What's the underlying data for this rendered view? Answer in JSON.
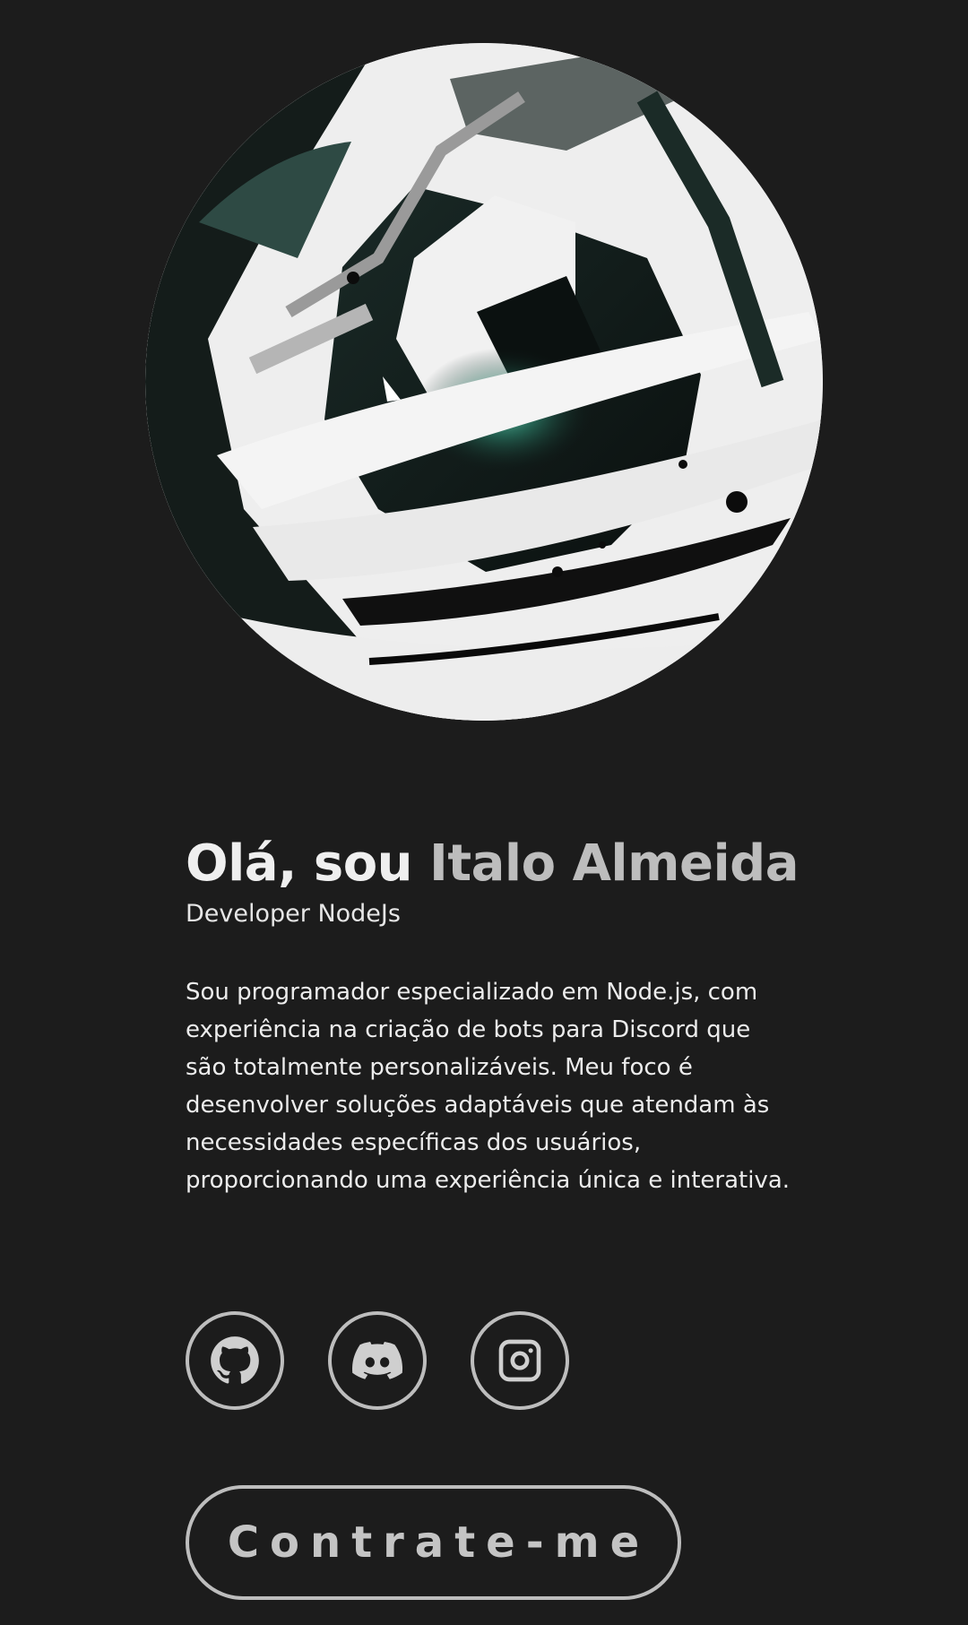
{
  "profile": {
    "avatar_alt": "abstract ink hooded figure avatar",
    "greeting_prefix": "Olá, sou ",
    "name": "Italo Almeida",
    "role": "Developer NodeJs",
    "bio": "Sou programador especializado em Node.js, com experiência na criação de bots para Discord que são totalmente personalizáveis. Meu foco é desenvolver soluções adaptáveis que atendam às necessidades específicas dos usuários, proporcionando uma experiência única e interativa."
  },
  "socials": [
    {
      "name": "GitHub",
      "icon": "github-icon"
    },
    {
      "name": "Discord",
      "icon": "discord-icon"
    },
    {
      "name": "Instagram",
      "icon": "instagram-icon"
    }
  ],
  "cta": {
    "label": "Contrate-me"
  },
  "colors": {
    "background": "#1c1c1c",
    "text": "#efefef",
    "accent_gray": "#bdbdbd",
    "glow": "#4fc9a8"
  }
}
